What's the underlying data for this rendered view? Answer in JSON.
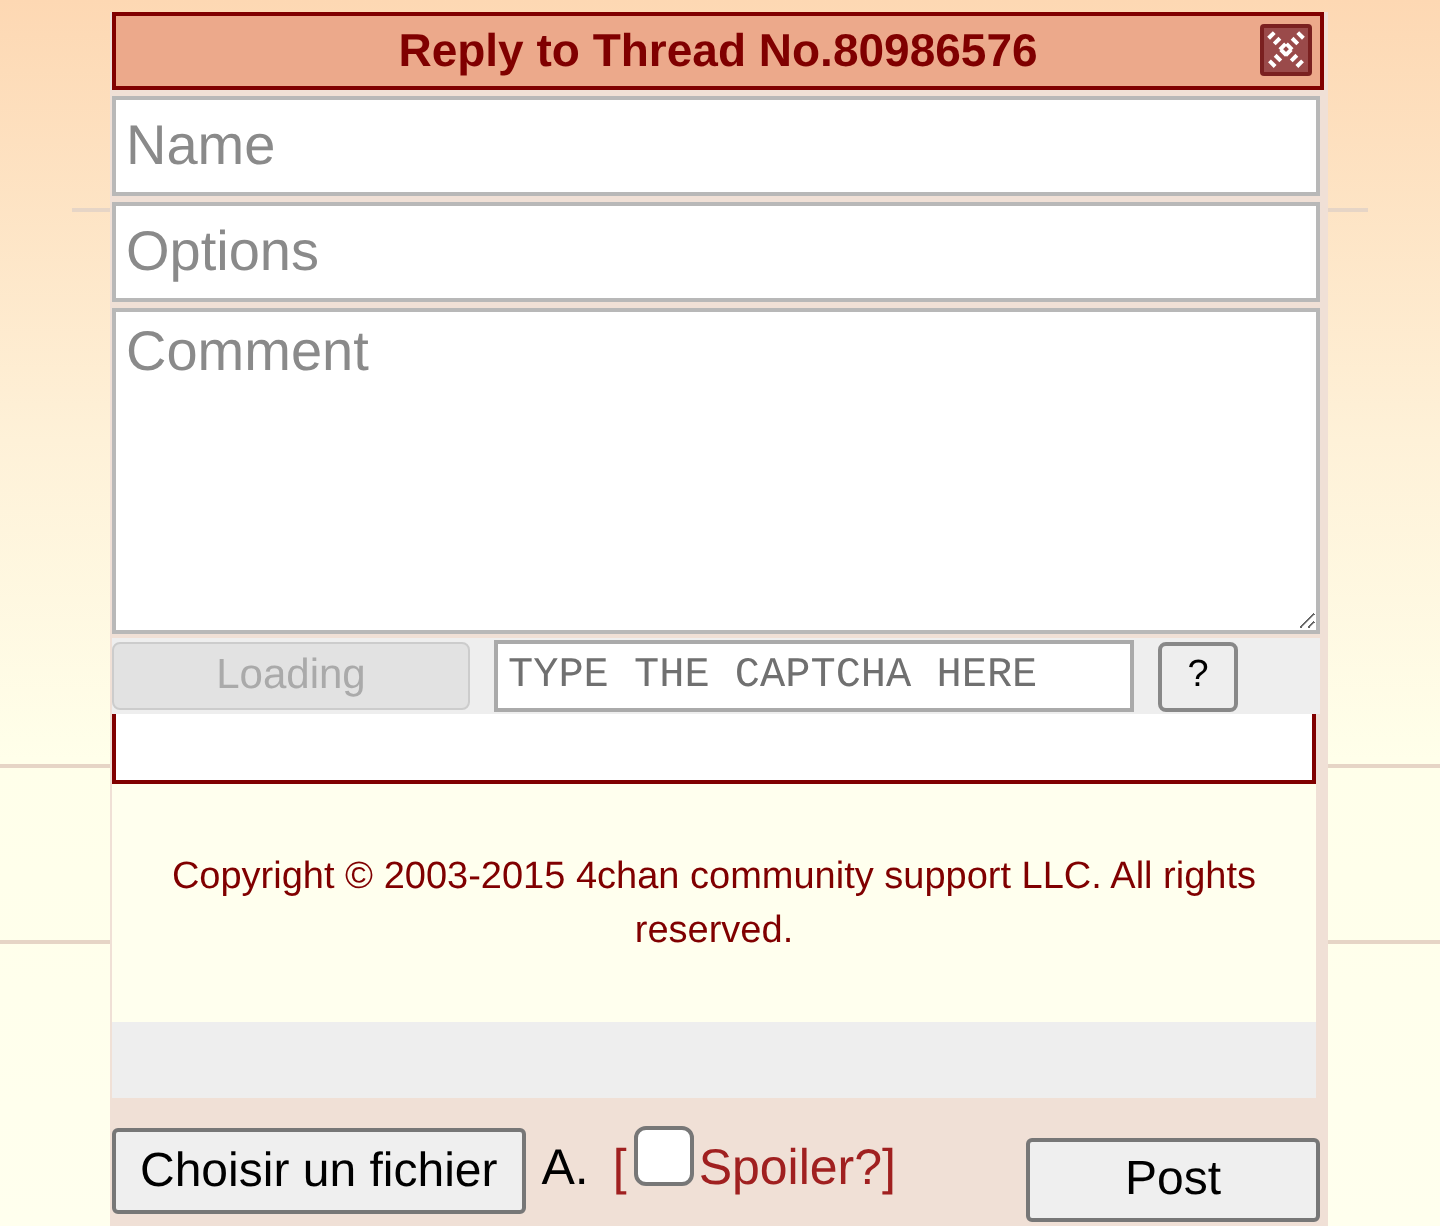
{
  "window": {
    "title": "Reply to Thread No.80986576"
  },
  "fields": [
    {
      "kind": "input",
      "placeholder": "Name"
    },
    {
      "kind": "input",
      "placeholder": "Options"
    },
    {
      "kind": "textarea",
      "placeholder": "Comment"
    }
  ],
  "captcha": {
    "button": {
      "label": "Loading",
      "disabled": true
    },
    "placeholder": "TYPE THE CAPTCHA HERE",
    "help": "?"
  },
  "copyright": "Copyright © 2003-2015 4chan community support LLC. All rights reserved.",
  "file_button": "Choisir un fichier",
  "file_status": "A.",
  "spoiler": {
    "open": "[",
    "label": "Spoiler?]",
    "checked": false
  },
  "post": "Post"
}
